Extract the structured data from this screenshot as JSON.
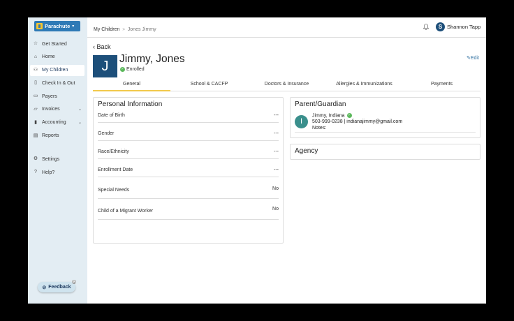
{
  "sidebar": {
    "logo_text": "Parachute",
    "items": [
      {
        "label": "Get Started",
        "icon": "star-icon"
      },
      {
        "label": "Home",
        "icon": "home-icon"
      },
      {
        "label": "My Children",
        "icon": "users-icon",
        "active": true
      },
      {
        "label": "Check In & Out",
        "icon": "clipboard-icon"
      },
      {
        "label": "Payers",
        "icon": "wallet-icon"
      },
      {
        "label": "Invoices",
        "icon": "folder-icon",
        "caret": true
      },
      {
        "label": "Accounting",
        "icon": "bar-chart-icon",
        "caret": true
      },
      {
        "label": "Reports",
        "icon": "document-icon"
      },
      {
        "label": "Settings",
        "icon": "gear-icon"
      },
      {
        "label": "Help?",
        "icon": "help-icon"
      }
    ],
    "feedback_label": "Feedback",
    "feedback_count": "1"
  },
  "header": {
    "breadcrumb_parent": "My Children",
    "breadcrumb_sep": ">",
    "breadcrumb_leaf": "Jones Jimmy",
    "user_initial": "S",
    "user_name": "Shannon Tapp"
  },
  "child": {
    "back_label": "Back",
    "initial": "J",
    "name": "Jimmy, Jones",
    "status": "Enrolled",
    "edit_label": "Edit"
  },
  "tabs": [
    "General",
    "School & CACFP",
    "Doctors & Insurance",
    "Allergies & Immunizations",
    "Payments"
  ],
  "personal_info": {
    "title": "Personal Information",
    "rows": [
      {
        "label": "Date of Birth",
        "value": "---"
      },
      {
        "label": "Gender",
        "value": "---"
      },
      {
        "label": "Race/Ethnicity",
        "value": "---"
      },
      {
        "label": "Enrollment Date",
        "value": "---"
      },
      {
        "label": "Special Needs",
        "value": "No"
      },
      {
        "label": "Child of a Migrant Worker",
        "value": "No"
      }
    ]
  },
  "guardian": {
    "title": "Parent/Guardian",
    "initial": "I",
    "name": "Jimmy, Indiana",
    "contact": "503-999-0238 | indianajimmy@gmail.com",
    "notes_label": "Notes:"
  },
  "agency": {
    "title": "Agency"
  },
  "colors": {
    "accent": "#1d4f7a",
    "tab_underline": "#f2c94c",
    "sidebar_bg": "#e3edf3",
    "verified": "#5cb85c"
  }
}
